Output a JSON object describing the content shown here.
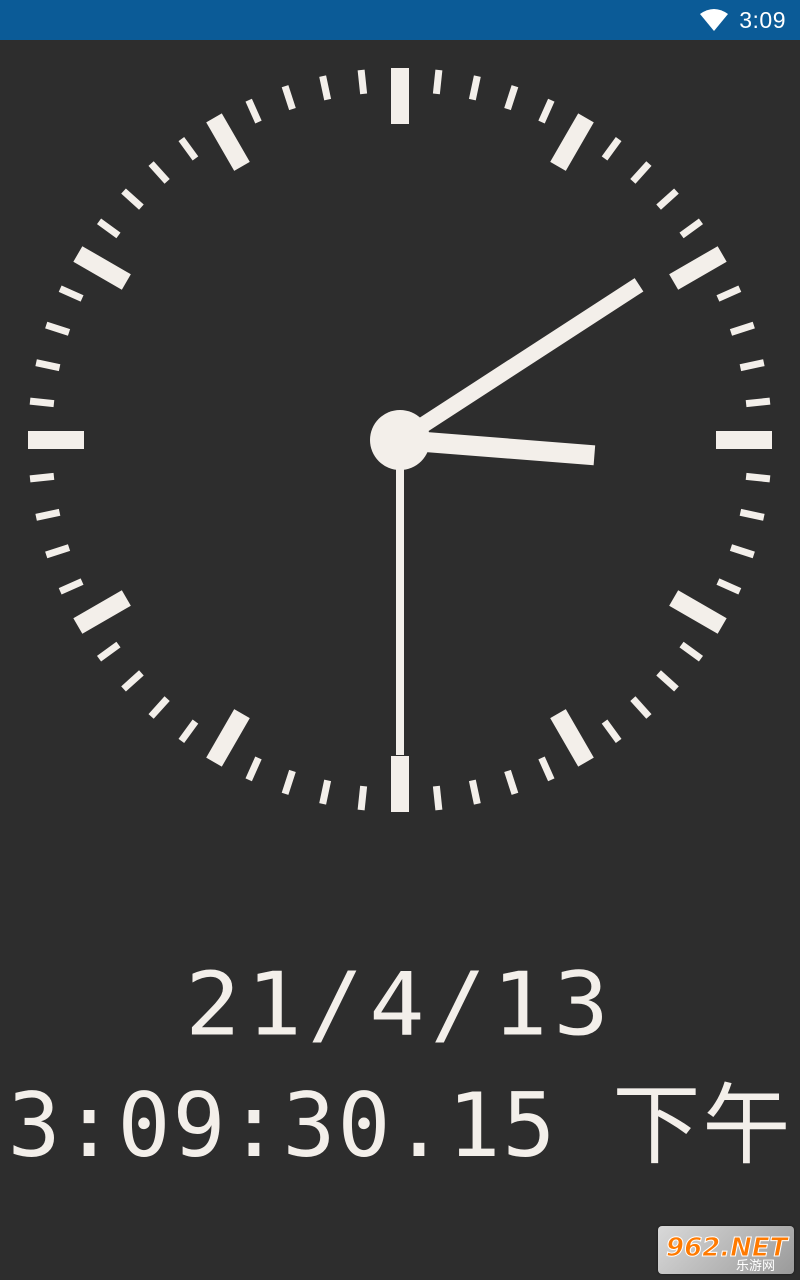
{
  "status_bar": {
    "time": "3:09",
    "background_color": "#0b5b97",
    "icons": [
      "wifi-icon"
    ]
  },
  "clock": {
    "hours": 3,
    "minutes": 9,
    "seconds": 30,
    "face_color": "#f3efea",
    "background_color": "#2d2d2d"
  },
  "digital": {
    "date": "21/4/13",
    "time": "3:09:30.15 下午"
  },
  "watermark": {
    "logo_text": "962.NET",
    "sub_text": "乐游网"
  }
}
